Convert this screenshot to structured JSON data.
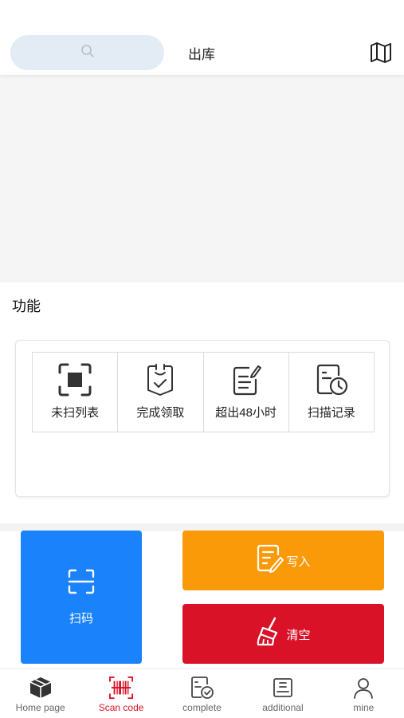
{
  "header": {
    "title": "出库",
    "search_icon": "search-icon",
    "map_icon": "map-icon"
  },
  "section": {
    "title": "功能"
  },
  "features": [
    {
      "label": "未扫列表",
      "icon": "scan-square-icon"
    },
    {
      "label": "完成领取",
      "icon": "check-badge-icon"
    },
    {
      "label": "超出48小时",
      "icon": "edit-doc-icon"
    },
    {
      "label": "扫描记录",
      "icon": "history-doc-icon"
    }
  ],
  "actions": {
    "scan_label": "扫码",
    "write_label": "写入",
    "clear_label": "清空"
  },
  "tabs": [
    {
      "label": "Home page",
      "icon": "box-icon",
      "active": false
    },
    {
      "label": "Scan code",
      "icon": "barcode-icon",
      "active": true
    },
    {
      "label": "complete",
      "icon": "doc-check-icon",
      "active": false
    },
    {
      "label": "additional",
      "icon": "list-icon",
      "active": false
    },
    {
      "label": "mine",
      "icon": "user-icon",
      "active": false
    }
  ],
  "colors": {
    "scan": "#1a82fb",
    "write": "#fb9a09",
    "clear": "#d91228",
    "active_tab": "#d91228"
  }
}
